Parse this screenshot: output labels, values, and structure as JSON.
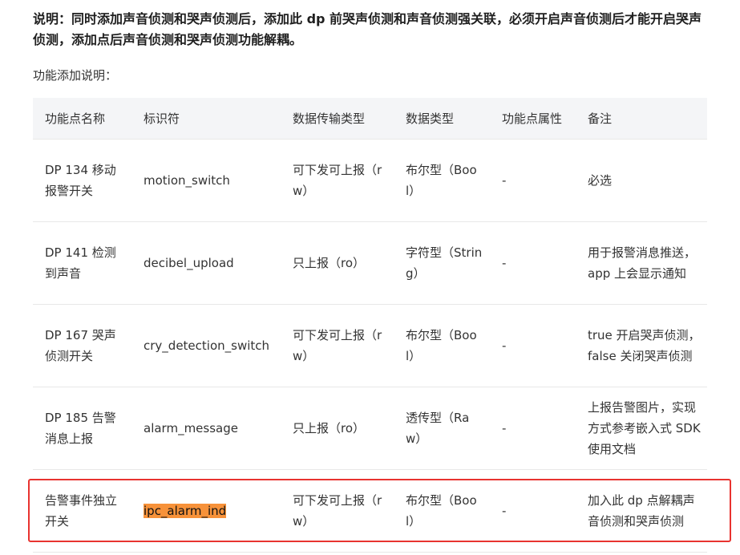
{
  "note": "说明：同时添加声音侦测和哭声侦测后，添加此 dp 前哭声侦测和声音侦测强关联，必须开启声音侦测后才能开启哭声侦测，添加点后声音侦测和哭声侦测功能解耦。",
  "func_label": "功能添加说明：",
  "table": {
    "headers": [
      "功能点名称",
      "标识符",
      "数据传输类型",
      "数据类型",
      "功能点属性",
      "备注"
    ],
    "rows": [
      {
        "name": "DP 134 移动报警开关",
        "id": "motion_switch",
        "transfer": "可下发可上报（rw）",
        "dtype": "布尔型（Bool）",
        "attr": "-",
        "remark": "必选"
      },
      {
        "name": "DP 141 检测到声音",
        "id": "decibel_upload",
        "transfer": "只上报（ro）",
        "dtype": "字符型（String）",
        "attr": "-",
        "remark": "用于报警消息推送，app 上会显示通知"
      },
      {
        "name": "DP 167 哭声侦测开关",
        "id": "cry_detection_switch",
        "transfer": "可下发可上报（rw）",
        "dtype": "布尔型（Bool）",
        "attr": "-",
        "remark": "true 开启哭声侦测，false 关闭哭声侦测"
      },
      {
        "name": "DP 185 告警消息上报",
        "id": "alarm_message",
        "transfer": "只上报（ro）",
        "dtype": "透传型（Raw）",
        "attr": "-",
        "remark": "上报告警图片，实现方式参考嵌入式 SDK 使用文档"
      },
      {
        "name": "告警事件独立开关",
        "id": "ipc_alarm_ind",
        "transfer": "可下发可上报（rw）",
        "dtype": "布尔型（Bool）",
        "attr": "-",
        "remark": "加入此 dp 点解耦声音侦测和哭声侦测"
      }
    ]
  },
  "colors": {
    "highlight": "#f7923a",
    "annotation_box": "#e8332f",
    "header_bg": "#f4f5f7"
  }
}
